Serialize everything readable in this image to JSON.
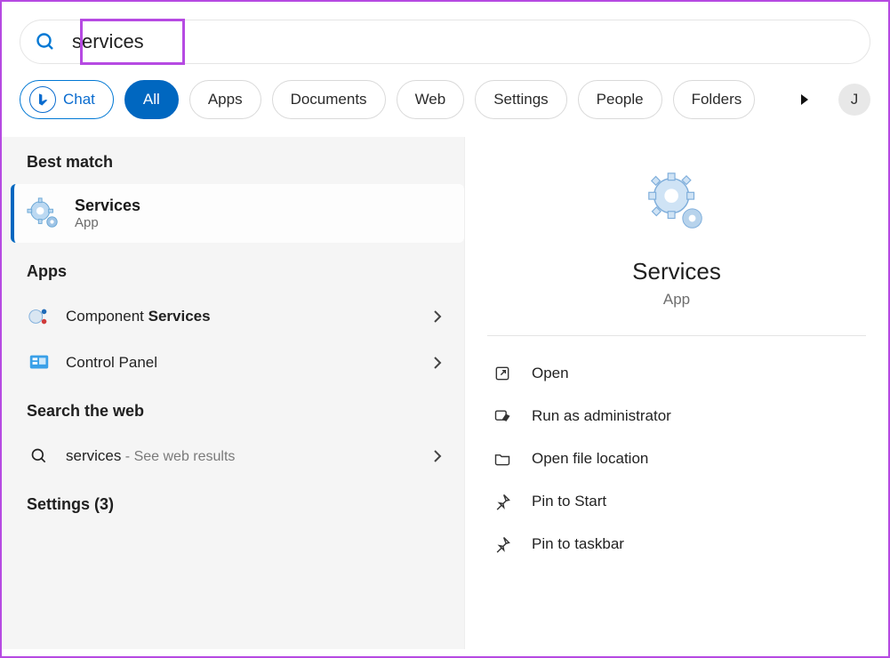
{
  "search": {
    "value": "services"
  },
  "filters": {
    "chat": "Chat",
    "all": "All",
    "apps": "Apps",
    "documents": "Documents",
    "web": "Web",
    "settings": "Settings",
    "people": "People",
    "folders": "Folders"
  },
  "avatar_initial": "J",
  "left": {
    "best_match_label": "Best match",
    "best_match": {
      "title": "Services",
      "subtitle": "App"
    },
    "apps_label": "Apps",
    "apps": [
      {
        "prefix": "Component ",
        "bold": "Services"
      },
      {
        "prefix": "Control Panel",
        "bold": ""
      }
    ],
    "web_label": "Search the web",
    "web": {
      "term": "services",
      "suffix": " - See web results"
    },
    "settings_label": "Settings (3)"
  },
  "right": {
    "title": "Services",
    "subtitle": "App",
    "actions": {
      "open": "Open",
      "admin": "Run as administrator",
      "location": "Open file location",
      "pin_start": "Pin to Start",
      "pin_taskbar": "Pin to taskbar"
    }
  }
}
